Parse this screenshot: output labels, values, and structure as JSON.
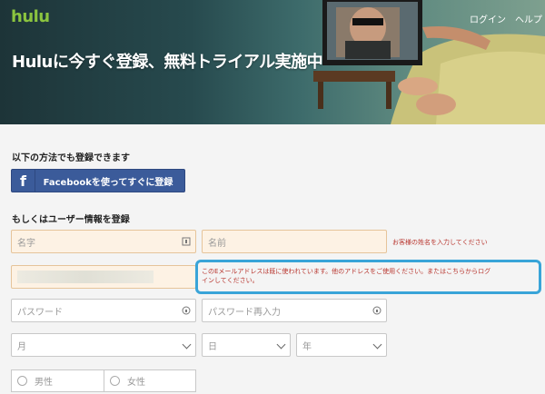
{
  "header": {
    "logo": "hulu",
    "login": "ログイン",
    "help": "ヘルプ",
    "headline": "Huluに今すぐ登録、無料トライアル実施中"
  },
  "social": {
    "title": "以下の方法でも登録できます",
    "fb_glyph": "f",
    "facebook_label": "Facebookを使ってすぐに登録"
  },
  "form": {
    "title": "もしくはユーザー情報を登録",
    "last_name_placeholder": "名字",
    "first_name_placeholder": "名前",
    "name_error": "お客様の姓名を入力してください",
    "email_error_line1": "このEメールアドレスは既に使われています。他のアドレスをご使用ください。またはこちらからログ",
    "email_error_line2": "インしてください。",
    "password_placeholder": "パスワード",
    "password_confirm_placeholder": "パスワード再入力",
    "month_label": "月",
    "day_label": "日",
    "year_label": "年",
    "gender_male": "男性",
    "gender_female": "女性"
  },
  "colors": {
    "hulu_green": "#8bc43f",
    "facebook_blue": "#3b5b9a",
    "error_red": "#b8352e",
    "highlight_blue": "#39a4d8"
  }
}
